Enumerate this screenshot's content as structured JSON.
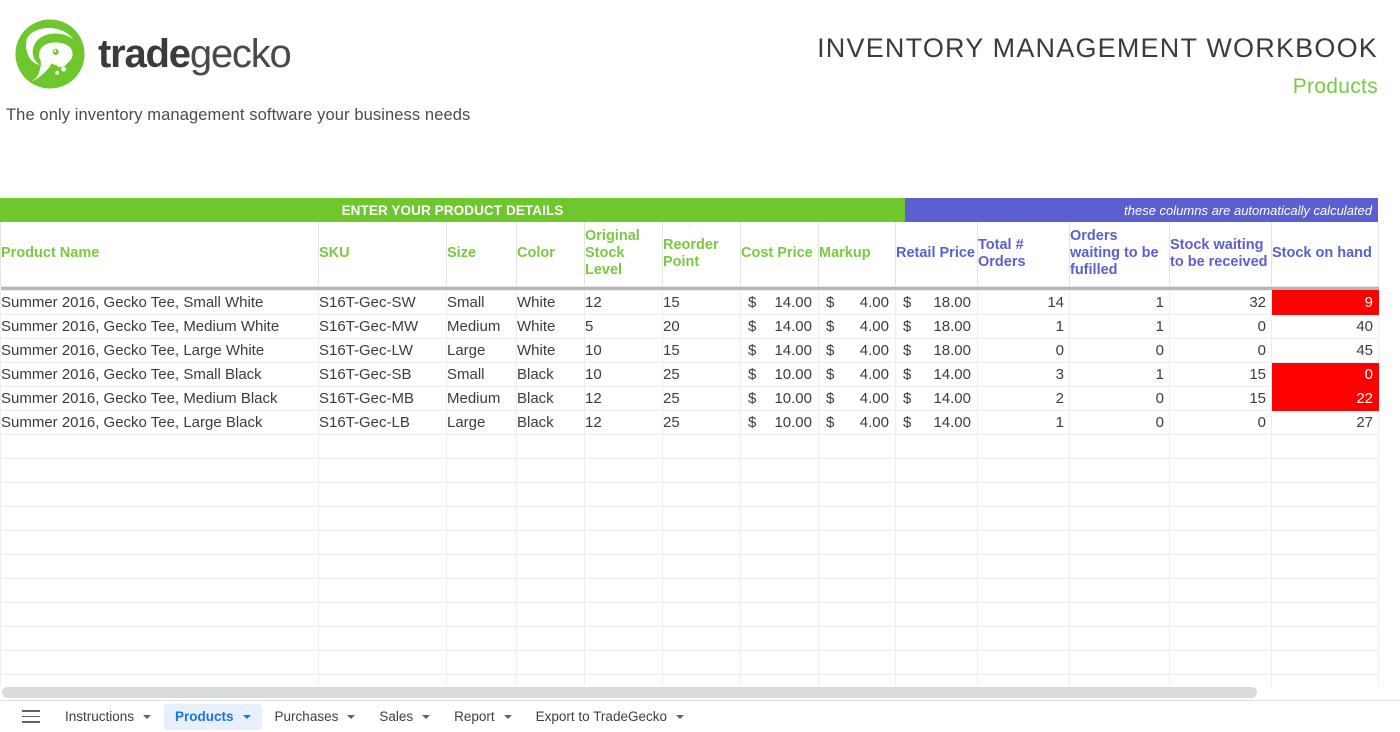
{
  "brand": {
    "name_bold": "trade",
    "name_light": "gecko",
    "logo_icon": "gecko-logo-icon",
    "tagline": "The only inventory management software your business needs"
  },
  "header": {
    "workbook_title": "INVENTORY MANAGEMENT  WORKBOOK",
    "sheet_label": "Products"
  },
  "colors": {
    "brand_green": "#7ac943",
    "band_green": "#6ec72c",
    "band_blue": "#5b5fd0",
    "danger_red": "#ff0000",
    "tab_active_blue": "#1a73e8",
    "tab_active_bg": "#e8f0fe"
  },
  "sheet": {
    "bands": {
      "entry_label": "ENTER YOUR PRODUCT DETAILS",
      "calculated_label": "these  columns are automatically calculated"
    },
    "columns": [
      {
        "label": "Product Name",
        "group": "entry",
        "align": "left"
      },
      {
        "label": "SKU",
        "group": "entry",
        "align": "left"
      },
      {
        "label": "Size",
        "group": "entry",
        "align": "left"
      },
      {
        "label": "Color",
        "group": "entry",
        "align": "left"
      },
      {
        "label": "Original Stock Level",
        "group": "entry",
        "align": "left"
      },
      {
        "label": "Reorder Point",
        "group": "entry",
        "align": "left"
      },
      {
        "label": "Cost Price",
        "group": "entry",
        "align": "money"
      },
      {
        "label": "Markup",
        "group": "entry",
        "align": "money"
      },
      {
        "label": "Retail Price",
        "group": "calculated",
        "align": "money"
      },
      {
        "label": "Total # Orders",
        "group": "calculated",
        "align": "right"
      },
      {
        "label": "Orders waiting to be fufilled",
        "group": "calculated",
        "align": "right"
      },
      {
        "label": "Stock waiting to be received",
        "group": "calculated",
        "align": "right"
      },
      {
        "label": "Stock on hand",
        "group": "calculated",
        "align": "right"
      }
    ],
    "rows": [
      {
        "product_name": "Summer 2016, Gecko Tee, Small White",
        "sku": "S16T-Gec-SW",
        "size": "Small",
        "color": "White",
        "original_stock_level": "12",
        "reorder_point": "15",
        "cost_price_currency": "$",
        "cost_price": "14.00",
        "markup_currency": "$",
        "markup": "4.00",
        "retail_price_currency": "$",
        "retail_price": "18.00",
        "total_orders": "14",
        "orders_waiting": "1",
        "stock_waiting": "32",
        "stock_on_hand": "9",
        "stock_alert": true
      },
      {
        "product_name": "Summer 2016, Gecko Tee, Medium White",
        "sku": "S16T-Gec-MW",
        "size": "Medium",
        "color": "White",
        "original_stock_level": "5",
        "reorder_point": "20",
        "cost_price_currency": "$",
        "cost_price": "14.00",
        "markup_currency": "$",
        "markup": "4.00",
        "retail_price_currency": "$",
        "retail_price": "18.00",
        "total_orders": "1",
        "orders_waiting": "1",
        "stock_waiting": "0",
        "stock_on_hand": "40",
        "stock_alert": false
      },
      {
        "product_name": "Summer 2016, Gecko Tee, Large White",
        "sku": "S16T-Gec-LW",
        "size": "Large",
        "color": "White",
        "original_stock_level": "10",
        "reorder_point": "15",
        "cost_price_currency": "$",
        "cost_price": "14.00",
        "markup_currency": "$",
        "markup": "4.00",
        "retail_price_currency": "$",
        "retail_price": "18.00",
        "total_orders": "0",
        "orders_waiting": "0",
        "stock_waiting": "0",
        "stock_on_hand": "45",
        "stock_alert": false
      },
      {
        "product_name": "Summer 2016, Gecko Tee, Small Black",
        "sku": "S16T-Gec-SB",
        "size": "Small",
        "color": "Black",
        "original_stock_level": "10",
        "reorder_point": "25",
        "cost_price_currency": "$",
        "cost_price": "10.00",
        "markup_currency": "$",
        "markup": "4.00",
        "retail_price_currency": "$",
        "retail_price": "14.00",
        "total_orders": "3",
        "orders_waiting": "1",
        "stock_waiting": "15",
        "stock_on_hand": "0",
        "stock_alert": true
      },
      {
        "product_name": "Summer 2016, Gecko Tee, Medium Black",
        "sku": "S16T-Gec-MB",
        "size": "Medium",
        "color": "Black",
        "original_stock_level": "12",
        "reorder_point": "25",
        "cost_price_currency": "$",
        "cost_price": "10.00",
        "markup_currency": "$",
        "markup": "4.00",
        "retail_price_currency": "$",
        "retail_price": "14.00",
        "total_orders": "2",
        "orders_waiting": "0",
        "stock_waiting": "15",
        "stock_on_hand": "22",
        "stock_alert": true
      },
      {
        "product_name": "Summer 2016, Gecko Tee, Large Black",
        "sku": "S16T-Gec-LB",
        "size": "Large",
        "color": "Black",
        "original_stock_level": "12",
        "reorder_point": "25",
        "cost_price_currency": "$",
        "cost_price": "10.00",
        "markup_currency": "$",
        "markup": "4.00",
        "retail_price_currency": "$",
        "retail_price": "14.00",
        "total_orders": "1",
        "orders_waiting": "0",
        "stock_waiting": "0",
        "stock_on_hand": "27",
        "stock_alert": false
      }
    ],
    "empty_row_count": 11
  },
  "tabbar": {
    "menu_icon": "hamburger-menu-icon",
    "tabs": [
      {
        "label": "Instructions",
        "active": false
      },
      {
        "label": "Products",
        "active": true
      },
      {
        "label": "Purchases",
        "active": false
      },
      {
        "label": "Sales",
        "active": false
      },
      {
        "label": "Report",
        "active": false
      },
      {
        "label": "Export to TradeGecko",
        "active": false
      }
    ]
  }
}
